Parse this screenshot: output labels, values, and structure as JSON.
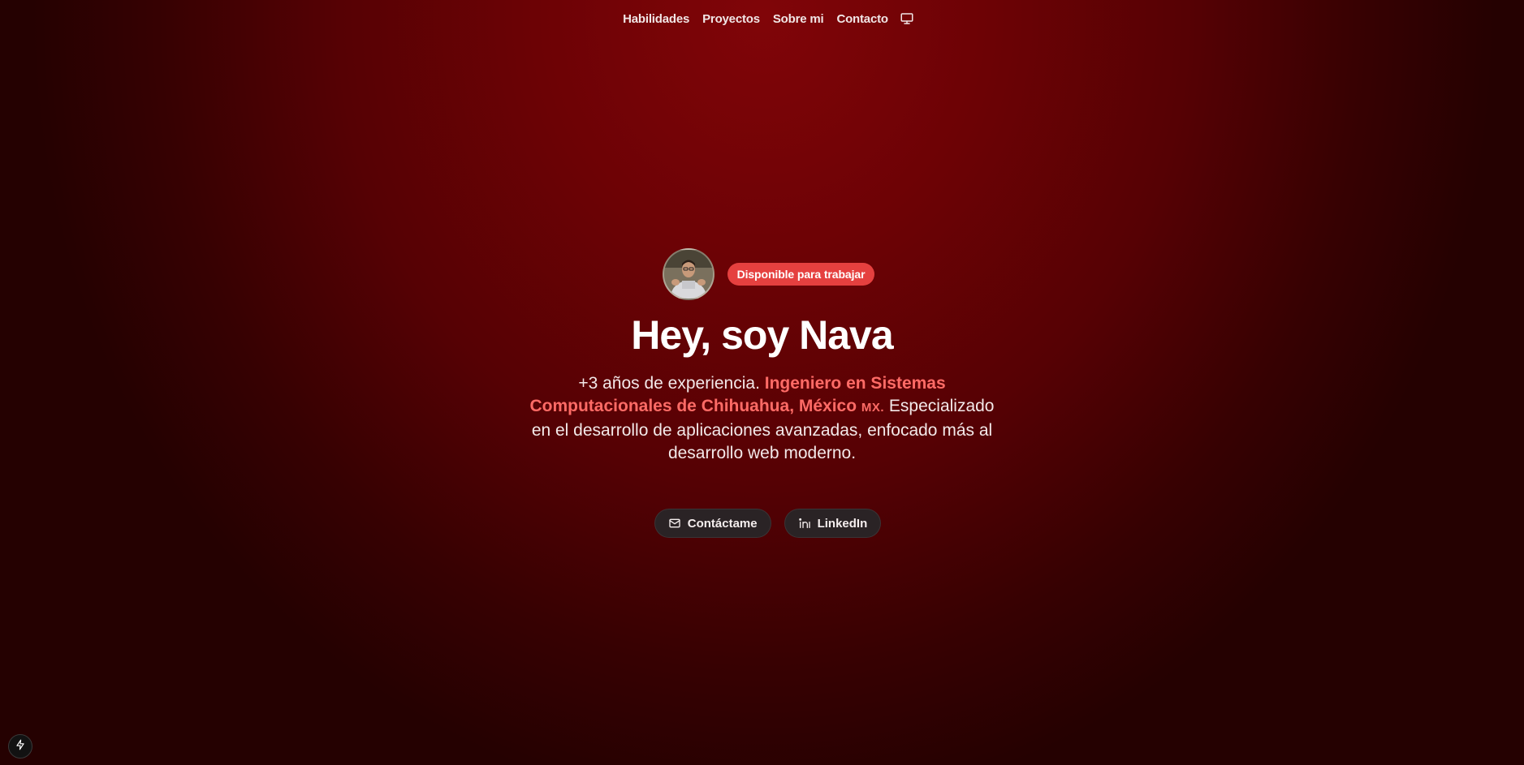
{
  "nav": {
    "items": [
      {
        "label": "Habilidades"
      },
      {
        "label": "Proyectos"
      },
      {
        "label": "Sobre mi"
      },
      {
        "label": "Contacto"
      }
    ],
    "theme_icon": "monitor-icon"
  },
  "hero": {
    "badge": "Disponible para trabajar",
    "title": "Hey, soy Nava",
    "intro": {
      "part1": "+3 años de experiencia. ",
      "highlight": "Ingeniero en Sistemas Computacionales de Chihuahua, México",
      "flag": "MX.",
      "part2": " Especializado en el desarrollo de aplicaciones avanzadas, enfocado más al desarrollo web moderno."
    },
    "buttons": {
      "contact_label": "Contáctame",
      "contact_icon": "mail-icon",
      "linkedin_label": "LinkedIn",
      "linkedin_icon": "linkedin-icon"
    }
  },
  "corner_widget": {
    "icon": "lightning-icon"
  },
  "colors": {
    "background_center": "#800508",
    "background_edge": "#250101",
    "accent": "#e5403f",
    "highlight_text": "#ff6b66",
    "button_bg": "#2a2325"
  }
}
